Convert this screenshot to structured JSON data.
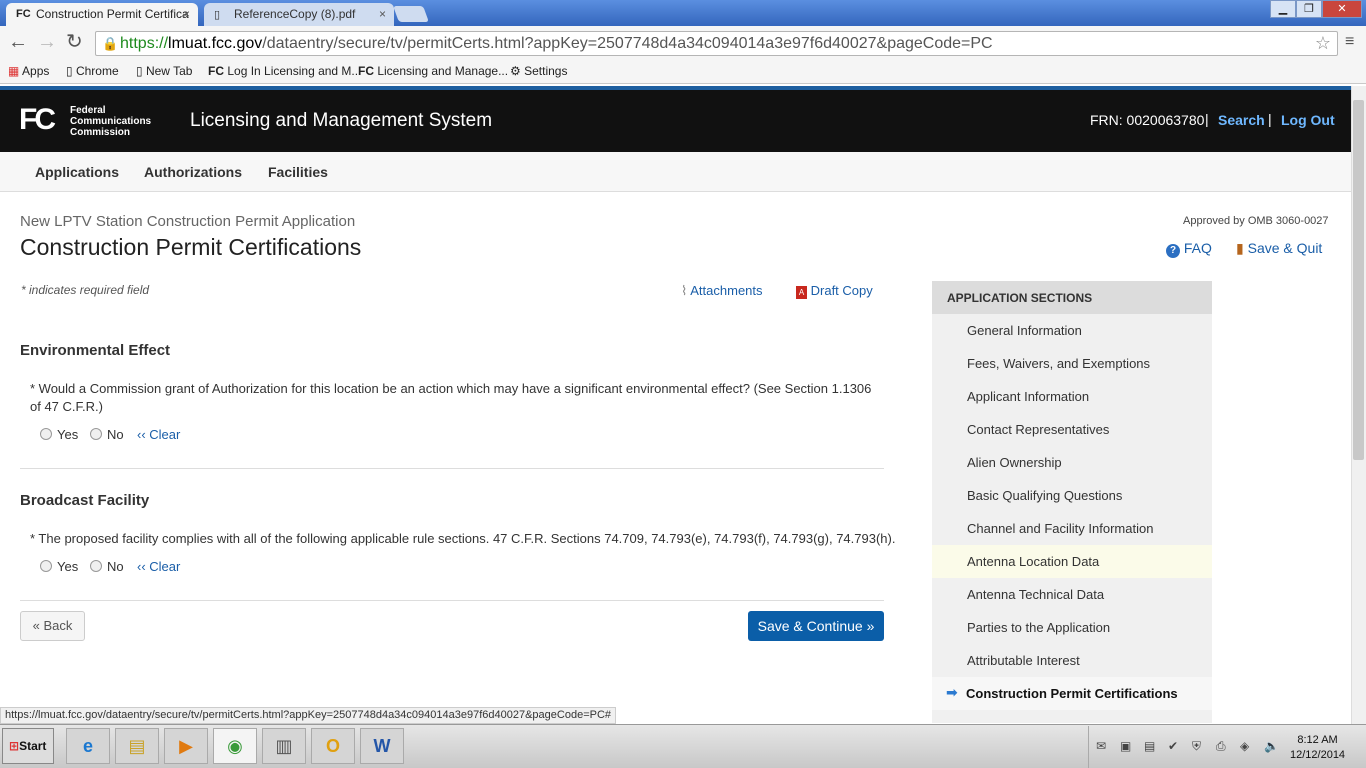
{
  "browser": {
    "tabs": [
      {
        "favicon": "FC",
        "title": "Construction Permit Certifica",
        "close": "×"
      },
      {
        "favicon": "▯",
        "title": "ReferenceCopy (8).pdf",
        "close": "×"
      }
    ],
    "window_buttons": [
      "▁",
      "❐",
      "✕"
    ],
    "url_protocol": "https://",
    "url_host": "lmuat.fcc.gov",
    "url_path": "/dataentry/secure/tv/permitCerts.html?appKey=2507748d4a34c094014a3e97f6d40027&pageCode=PC",
    "bookmarks": [
      "Apps",
      "Chrome",
      "New Tab",
      "Log In Licensing and M...",
      "Licensing and Manage...",
      "Settings"
    ],
    "status_url": "https://lmuat.fcc.gov/dataentry/secure/tv/permitCerts.html?appKey=2507748d4a34c094014a3e97f6d40027&pageCode=PC#"
  },
  "header": {
    "logo": "FC",
    "agency_lines": [
      "Federal",
      "Communications",
      "Commission"
    ],
    "system_title": "Licensing and Management System",
    "frn": "FRN: 0020063780",
    "separator": "|",
    "search_link": "Search",
    "logout_link": "Log Out"
  },
  "nav": [
    "Applications",
    "Authorizations",
    "Facilities"
  ],
  "page": {
    "subtitle": "New LPTV Station Construction Permit Application",
    "title": "Construction Permit Certifications",
    "omb": "Approved by OMB 3060-0027",
    "faq": "FAQ",
    "save_quit": "Save & Quit",
    "required_note": "* indicates required field",
    "attachments": "Attachments",
    "draft_copy": "Draft Copy"
  },
  "sections": [
    {
      "heading": "Environmental Effect",
      "question": "* Would a Commission grant of Authorization for this location be an action which may have a significant environmental effect? (See Section 1.1306 of 47 C.F.R.)",
      "yes": "Yes",
      "no": "No",
      "clear": "‹‹ Clear"
    },
    {
      "heading": "Broadcast Facility",
      "question": "* The proposed facility complies with all of the following applicable rule sections. 47 C.F.R. Sections 74.709, 74.793(e), 74.793(f), 74.793(g), 74.793(h).",
      "yes": "Yes",
      "no": "No",
      "clear": "‹‹ Clear"
    }
  ],
  "buttons": {
    "back": "« Back",
    "save_continue": "Save & Continue »"
  },
  "sidebar": {
    "heading": "APPLICATION SECTIONS",
    "items": [
      "General Information",
      "Fees, Waivers, and Exemptions",
      "Applicant Information",
      "Contact Representatives",
      "Alien Ownership",
      "Basic Qualifying Questions",
      "Channel and Facility Information",
      "Antenna Location Data",
      "Antenna Technical Data",
      "Parties to the Application",
      "Attributable Interest",
      "Construction Permit Certifications"
    ],
    "highlighted_index": 7,
    "current_index": 11,
    "current_marker": "➡"
  },
  "taskbar": {
    "start": "Start",
    "apps": [
      "e",
      "▤",
      "▶",
      "◉",
      "▥",
      "O",
      "W"
    ],
    "clock_time": "8:12 AM",
    "clock_date": "12/12/2014"
  },
  "colors": {
    "link": "#1a5ea8",
    "primary_button": "#0b5ea8",
    "header_bg": "#111111",
    "highlight_row": "#fbfbe9"
  }
}
